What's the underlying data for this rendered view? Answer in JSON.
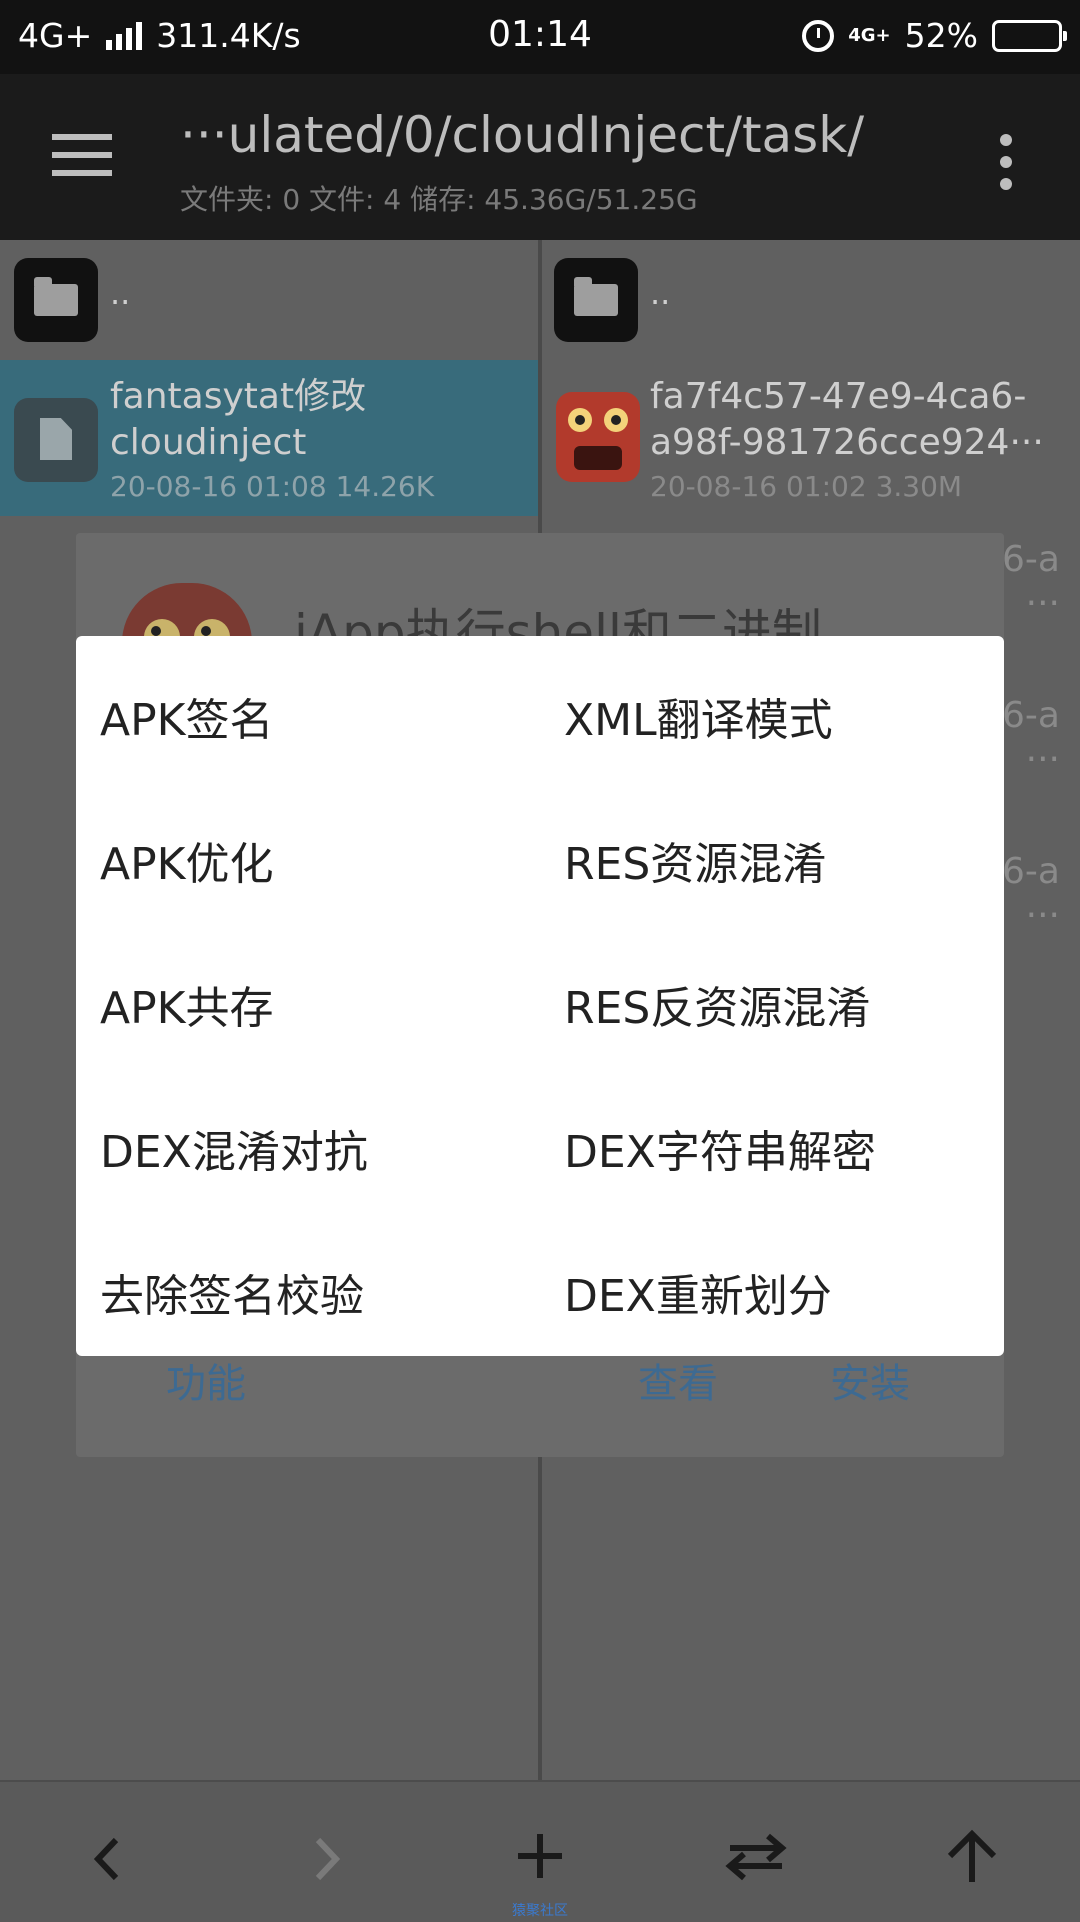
{
  "status_bar": {
    "network": "4G+",
    "speed": "311.4K/s",
    "time": "01:14",
    "net_small": "4G+",
    "battery": "52%",
    "battery_level": 0.52
  },
  "toolbar": {
    "path": "···ulated/0/cloudInject/task/",
    "summary": "文件夹: 0  文件: 4  储存: 45.36G/51.25G"
  },
  "left_pane": {
    "parent_label": "..",
    "selected_file": {
      "name_line1": "fantasytat修改",
      "name_line2": "cloudinject",
      "meta": "20-08-16 01:08  14.26K"
    }
  },
  "right_pane": {
    "parent_label": "..",
    "file": {
      "name_line1": "fa7f4c57-47e9-4ca6-",
      "name_line2": "a98f-981726cce924···",
      "meta": "20-08-16 01:02  3.30M"
    },
    "peek_rows": [
      {
        "line1": "6-a",
        "line2": "···"
      },
      {
        "line1": "6-a",
        "line2": "···"
      },
      {
        "line1": "6-a",
        "line2": "···"
      }
    ]
  },
  "back_dialog": {
    "title": "iApp执行shell和二进制",
    "buttons": {
      "function": "功能",
      "view": "查看",
      "install": "安装"
    }
  },
  "menu": {
    "items": [
      "APK签名",
      "XML翻译模式",
      "APK优化",
      "RES资源混淆",
      "APK共存",
      "RES反资源混淆",
      "DEX混淆对抗",
      "DEX字符串解密",
      "去除签名校验",
      "DEX重新划分"
    ]
  },
  "bottom_bar": {
    "icons": [
      "chevron-left-icon",
      "chevron-right-icon",
      "plus-icon",
      "swap-icon",
      "arrow-up-icon"
    ]
  },
  "watermark": "猿聚社区"
}
